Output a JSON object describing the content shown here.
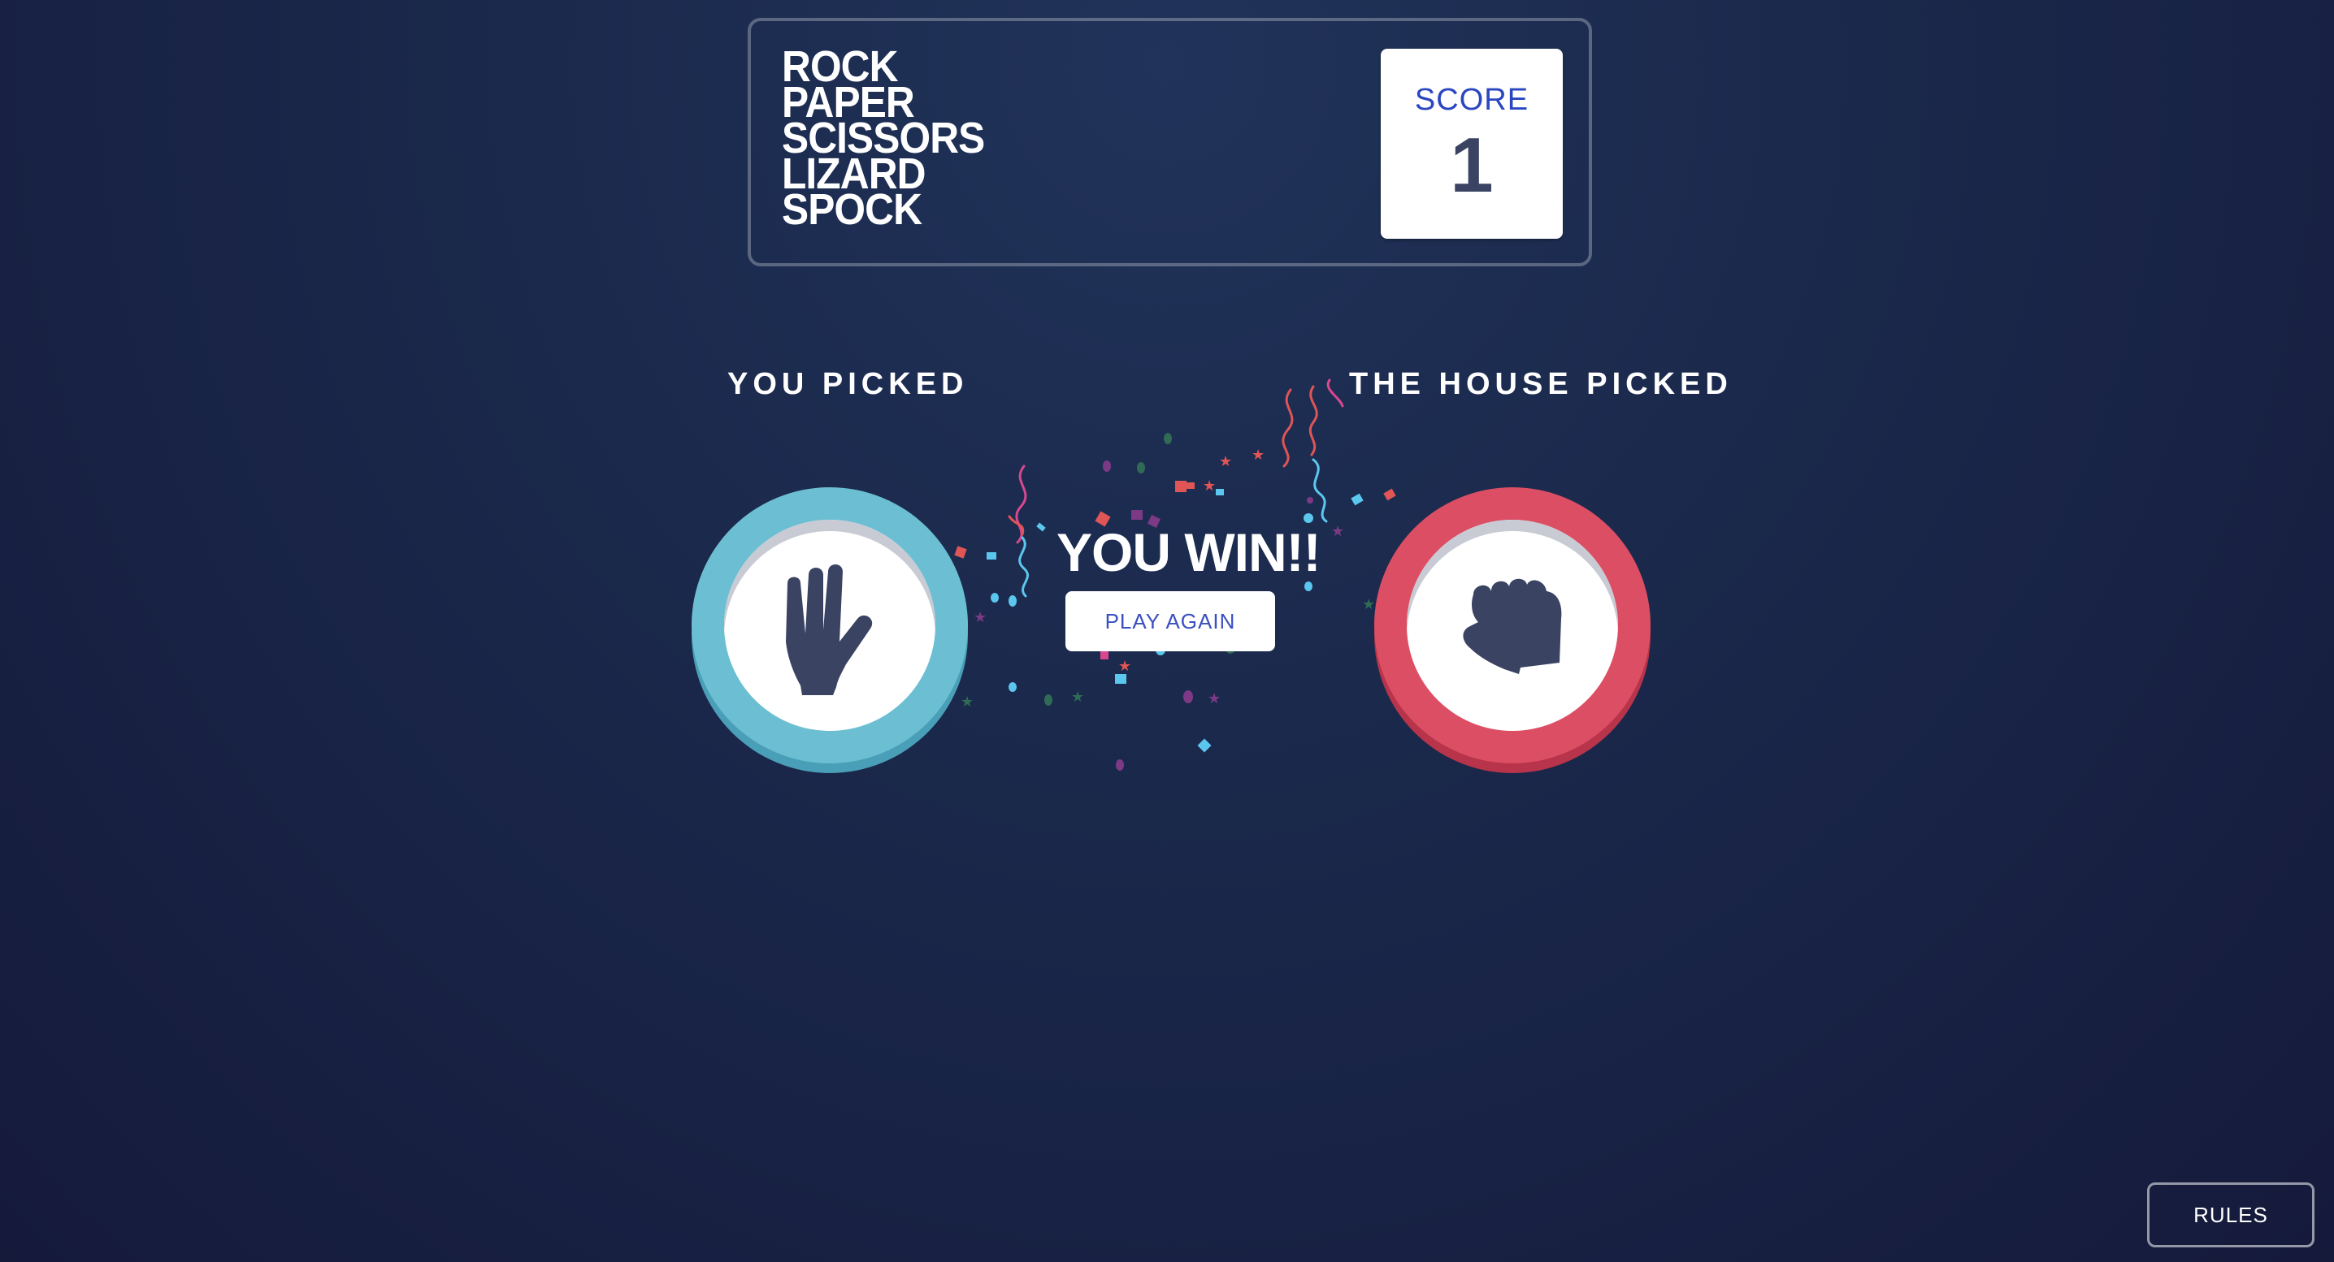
{
  "header": {
    "logo_lines": [
      "ROCK",
      "PAPER",
      "SCISSORS",
      "LIZARD",
      "SPOCK"
    ],
    "score_label": "SCORE",
    "score_value": "1"
  },
  "game": {
    "player_label": "YOU PICKED",
    "house_label": "THE HOUSE PICKED",
    "player_pick": {
      "name": "spock",
      "icon": "spock-hand-icon",
      "color": "#6cbfd2"
    },
    "house_pick": {
      "name": "rock",
      "icon": "rock-fist-icon",
      "color": "#dc4e63"
    },
    "result_text": "YOU WIN!!",
    "play_again_label": "PLAY AGAIN"
  },
  "footer": {
    "rules_label": "RULES"
  },
  "colors": {
    "background": "#1b2a4d",
    "score_label": "#2a46c0",
    "icon_dark": "#3b4363"
  }
}
